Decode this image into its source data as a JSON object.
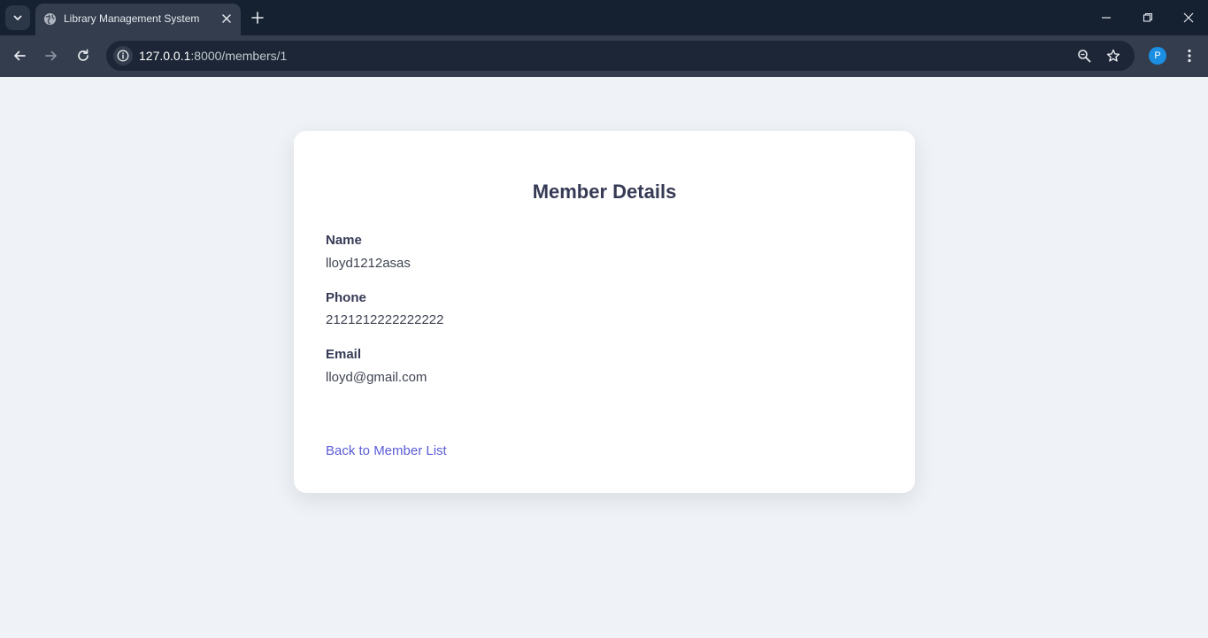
{
  "browser": {
    "tab_title": "Library Management System",
    "url_host": "127.0.0.1",
    "url_rest": ":8000/members/1",
    "profile_initial": "P"
  },
  "page": {
    "title": "Member Details",
    "fields": [
      {
        "label": "Name",
        "value": "lloyd1212asas"
      },
      {
        "label": "Phone",
        "value": "2121212222222222"
      },
      {
        "label": "Email",
        "value": "lloyd@gmail.com"
      }
    ],
    "back_link": "Back to Member List"
  },
  "colors": {
    "accent": "#5a5cd6",
    "heading": "#363a55",
    "page_bg": "#eff2f6"
  }
}
